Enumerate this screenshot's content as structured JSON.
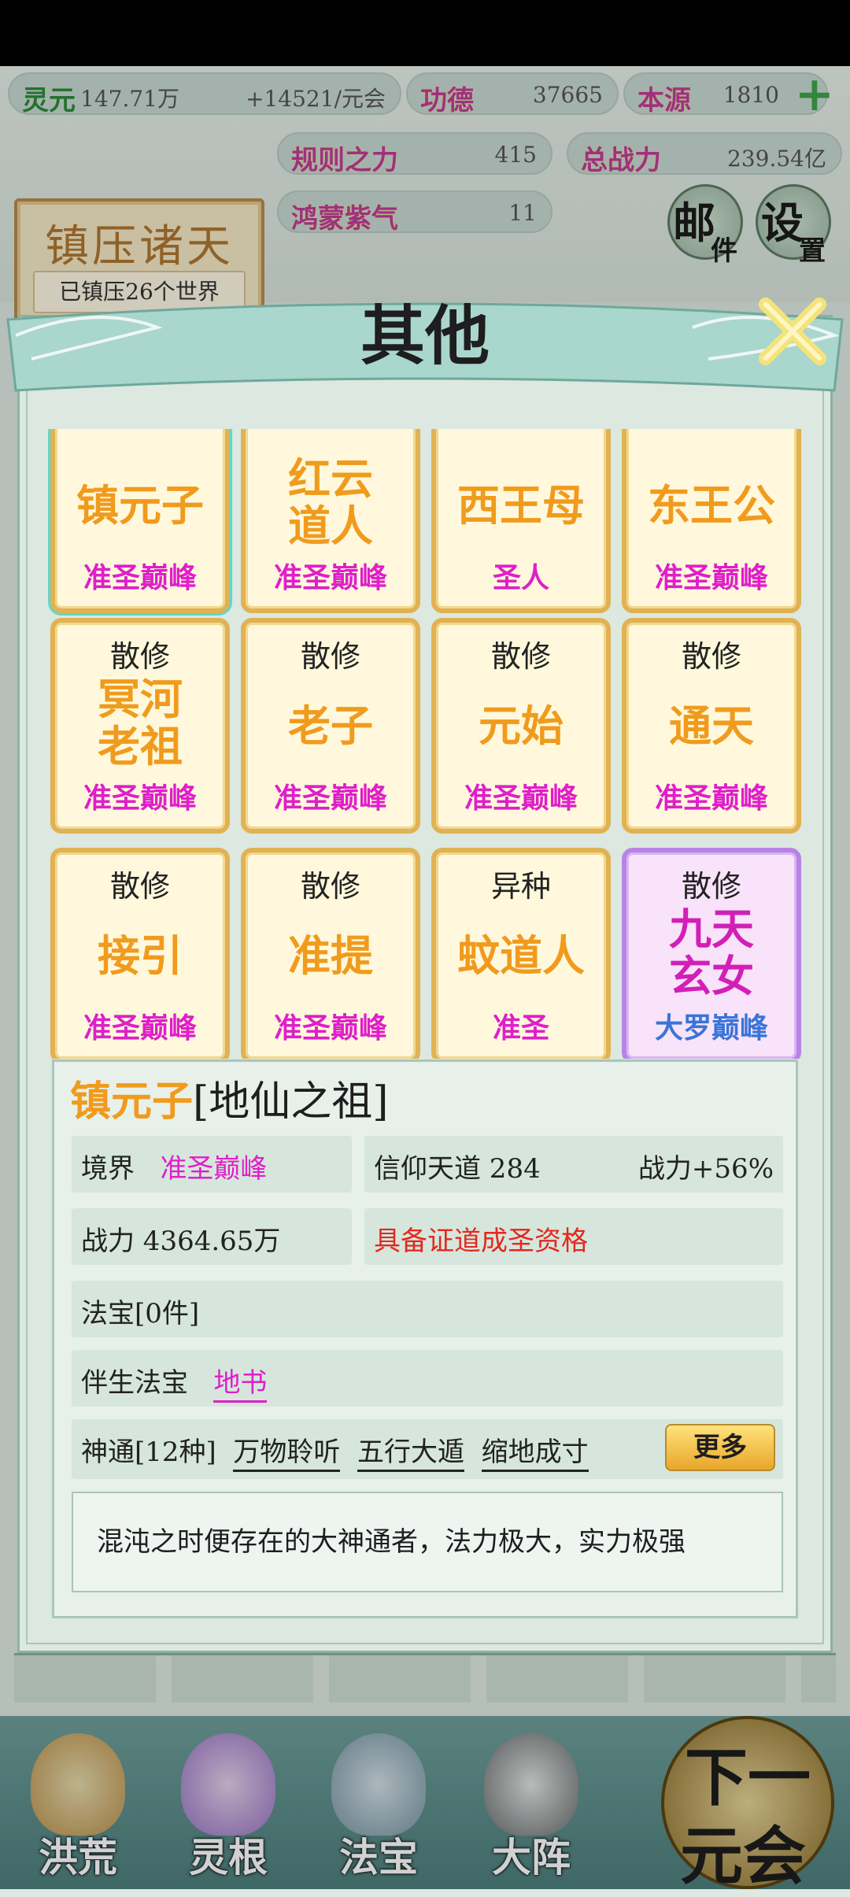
{
  "top": {
    "lingyuan": {
      "label": "灵元",
      "value": "147.71万",
      "rate": "+14521/元会"
    },
    "gongde": {
      "label": "功德",
      "value": "37665"
    },
    "benyuan": {
      "label": "本源",
      "value": "1810"
    },
    "guize": {
      "label": "规则之力",
      "value": "415"
    },
    "zongzhanli": {
      "label": "总战力",
      "value": "239.54亿"
    },
    "hongmeng": {
      "label": "鸿蒙紫气",
      "value": "11"
    },
    "zhenya_title": "镇压诸天",
    "zhenya_sub": "已镇压26个世界",
    "mail_label": [
      "邮",
      "件"
    ],
    "settings_label": [
      "设",
      "置"
    ]
  },
  "modal": {
    "title": "其他"
  },
  "cards": [
    {
      "top": "",
      "name": [
        "镇元子"
      ],
      "rank": "准圣巅峰",
      "selected": true
    },
    {
      "top": "",
      "name": [
        "红云",
        "道人"
      ],
      "rank": "准圣巅峰"
    },
    {
      "top": "",
      "name": [
        "西王母"
      ],
      "rank": "圣人"
    },
    {
      "top": "",
      "name": [
        "东王公"
      ],
      "rank": "准圣巅峰"
    },
    {
      "top": "散修",
      "name": [
        "冥河",
        "老祖"
      ],
      "rank": "准圣巅峰"
    },
    {
      "top": "散修",
      "name": [
        "老子"
      ],
      "rank": "准圣巅峰"
    },
    {
      "top": "散修",
      "name": [
        "元始"
      ],
      "rank": "准圣巅峰"
    },
    {
      "top": "散修",
      "name": [
        "通天"
      ],
      "rank": "准圣巅峰"
    },
    {
      "top": "散修",
      "name": [
        "接引"
      ],
      "rank": "准圣巅峰"
    },
    {
      "top": "散修",
      "name": [
        "准提"
      ],
      "rank": "准圣巅峰"
    },
    {
      "top": "异种",
      "name": [
        "蚊道人"
      ],
      "rank": "准圣"
    },
    {
      "top": "散修",
      "name": [
        "九天",
        "玄女"
      ],
      "rank": "大罗巅峰",
      "purple": true
    }
  ],
  "detail": {
    "name": "镇元子",
    "title": "[地仙之祖]",
    "jingjie_label": "境界",
    "jingjie_value": "准圣巅峰",
    "xinyang": "信仰天道  284",
    "xinyang_bonus": "战力+56%",
    "zhanli": "战力 4364.65万",
    "zhengdao": "具备证道成圣资格",
    "fabao": "法宝[0件]",
    "bansheng_label": "伴生法宝",
    "bansheng_value": "地书",
    "shentong_label": "神通[12种]",
    "shentong": [
      "万物聆听",
      "五行大遁",
      "缩地成寸"
    ],
    "more": "更多",
    "desc": "混沌之时便存在的大神通者，法力极大，实力极强"
  },
  "nav": [
    {
      "label": "洪荒"
    },
    {
      "label": "灵根"
    },
    {
      "label": "法宝"
    },
    {
      "label": "大阵"
    }
  ],
  "next": {
    "line1": "下一",
    "line2": "元会"
  }
}
